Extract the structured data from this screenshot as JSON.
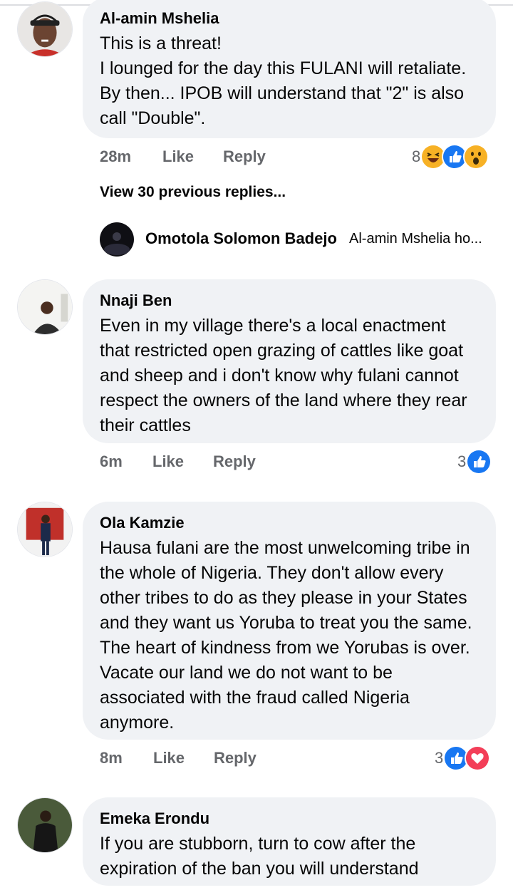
{
  "comments": [
    {
      "author": "Al-amin Mshelia",
      "text": "This is a threat!\nI lounged for the day this FULANI will retaliate. By then... IPOB will understand that \"2\" is also call \"Double\".",
      "time": "28m",
      "like": "Like",
      "reply": "Reply",
      "reaction_count": "8",
      "reactions": [
        "haha-icon",
        "like-icon",
        "wow-icon"
      ]
    },
    {
      "author": "Nnaji Ben",
      "text": "Even in my village there's a local enactment that restricted open grazing of cattles like goat and sheep and i don't know why fulani cannot respect the owners of the land where they rear their cattles",
      "time": "6m",
      "like": "Like",
      "reply": "Reply",
      "reaction_count": "3",
      "reactions": [
        "like-icon"
      ]
    },
    {
      "author": "Ola Kamzie",
      "text": "Hausa fulani are the most unwelcoming tribe in the whole of Nigeria. They don't allow every other tribes to do as they please in your States and they want us Yoruba to treat you the same. The heart of kindness from we Yorubas is over. Vacate our land we do not want to be associated with the fraud called Nigeria anymore.",
      "time": "8m",
      "like": "Like",
      "reply": "Reply",
      "reaction_count": "3",
      "reactions": [
        "like-icon",
        "love-icon"
      ]
    },
    {
      "author": "Emeka Erondu",
      "text": "If you are stubborn, turn to cow after the expiration of the ban you will understand"
    }
  ],
  "view_previous": "View 30 previous replies...",
  "latest_reply": {
    "author": "Omotola Solomon Badejo",
    "text": "Al-amin Mshelia ho..."
  },
  "colors": {
    "bubble": "#f0f2f5",
    "meta": "#65676b",
    "like_blue": "#1877f2",
    "love_red": "#f33e58",
    "haha_yellow": "#f7b125"
  }
}
